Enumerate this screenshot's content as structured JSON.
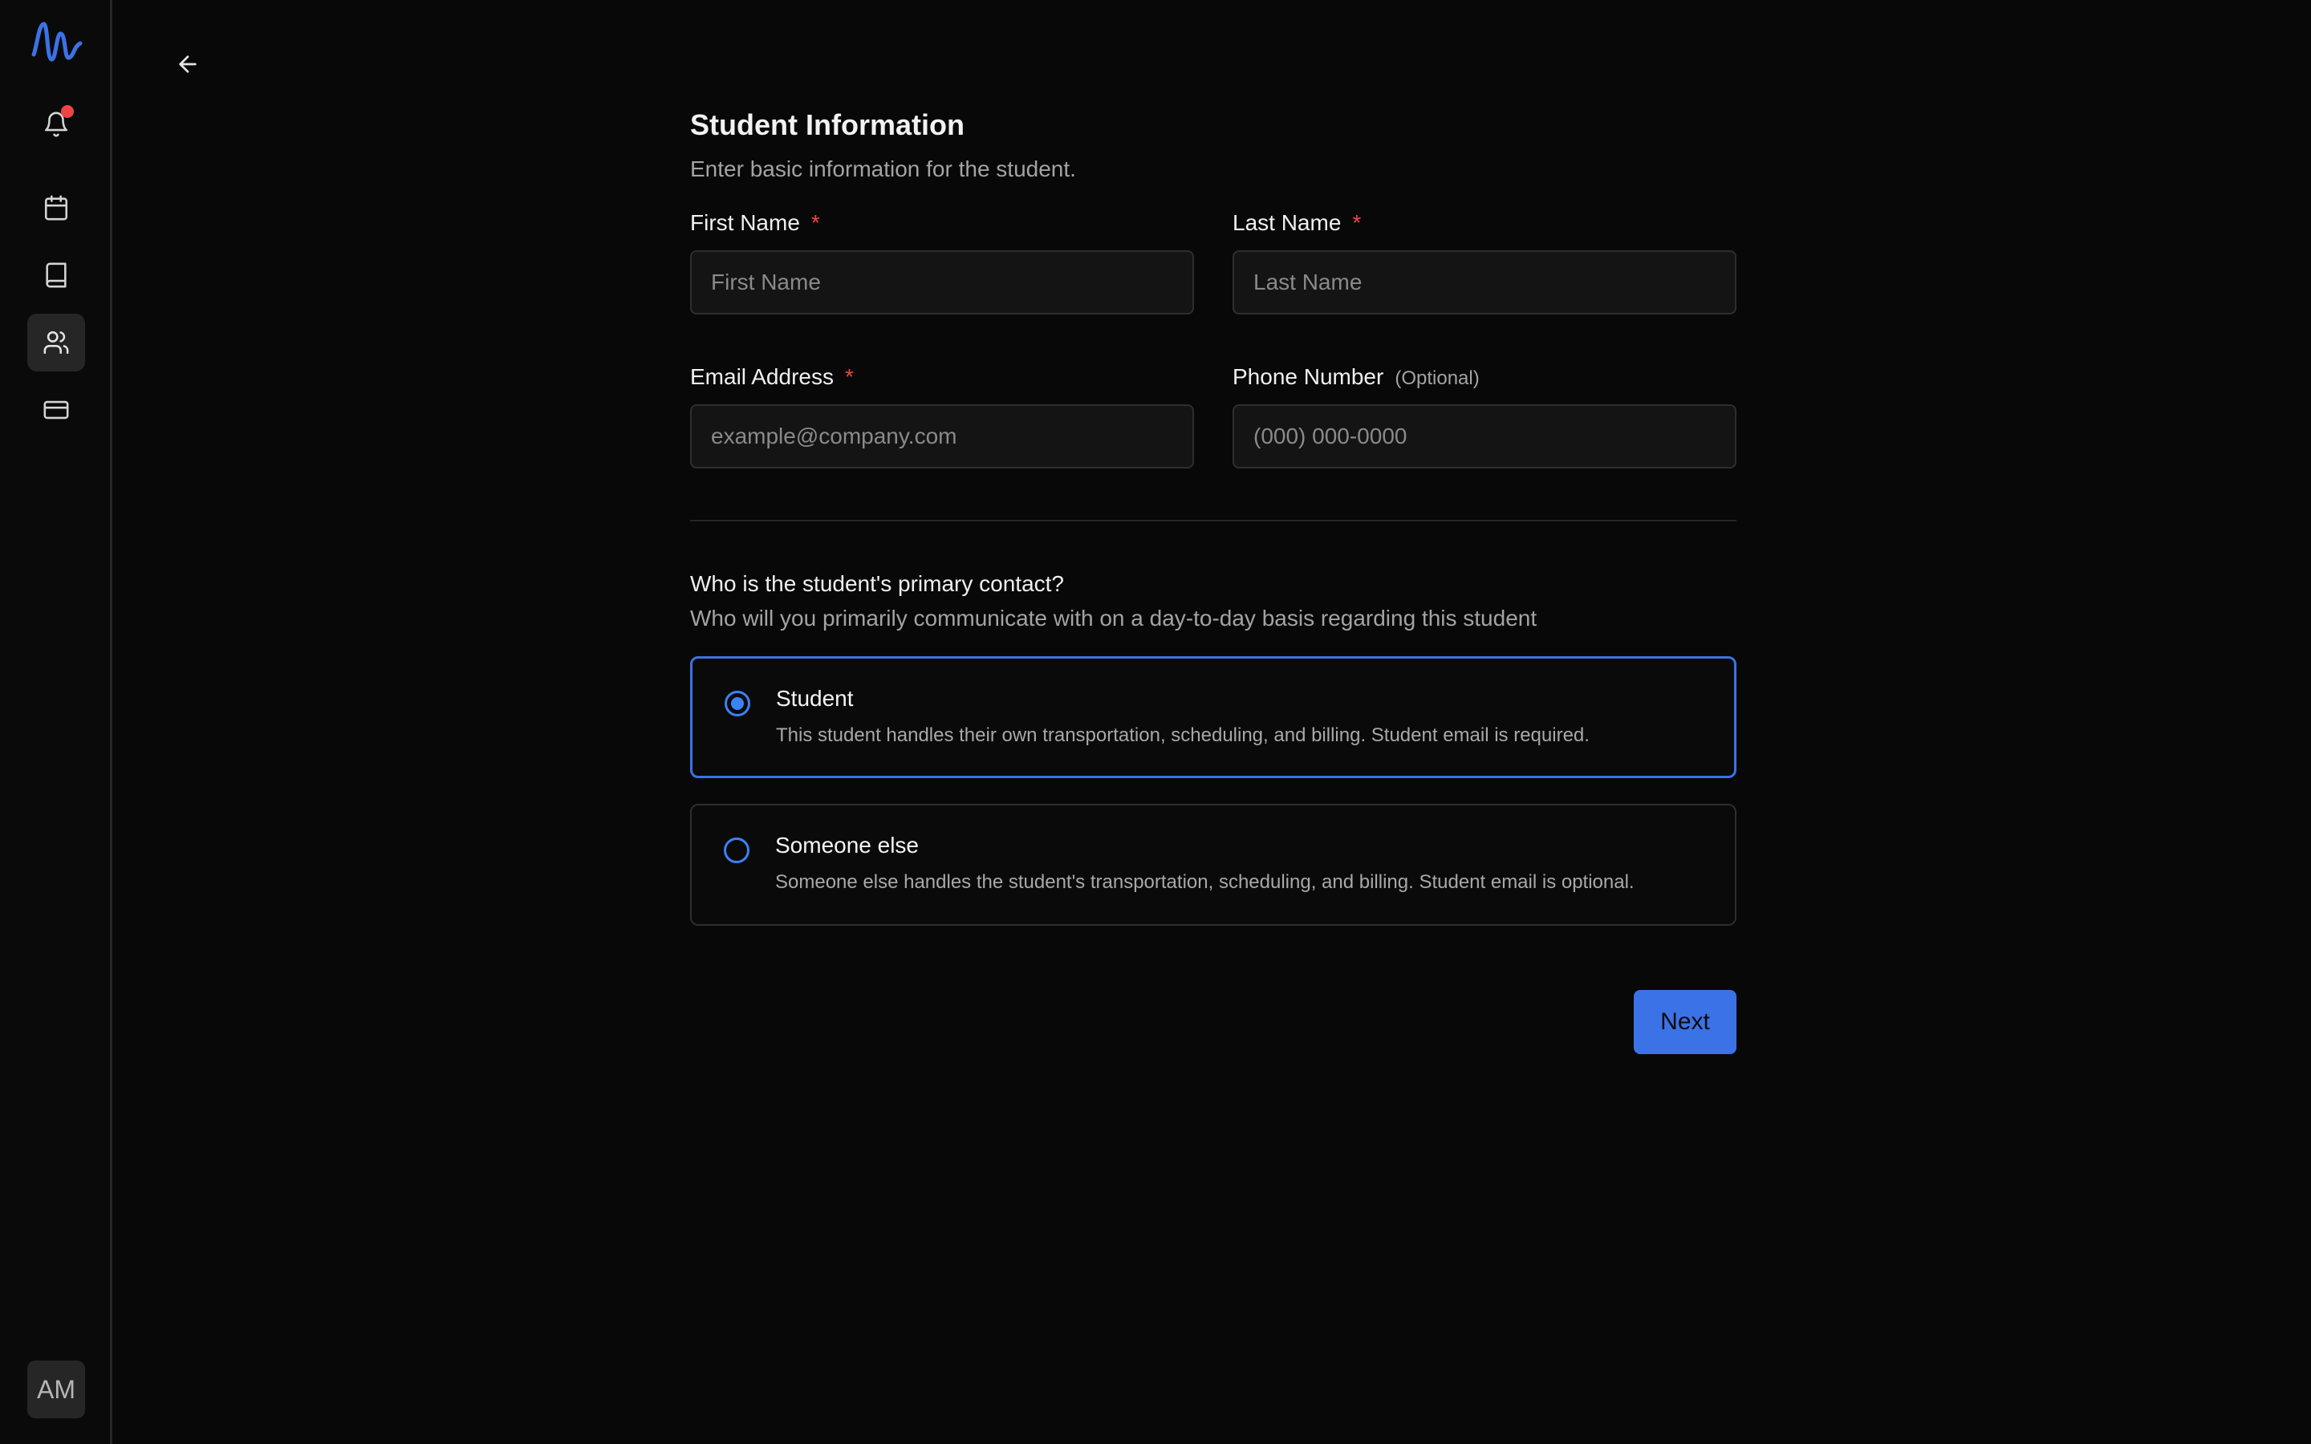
{
  "sidebar": {
    "logo_icon": "waveform-logo-icon",
    "items": [
      {
        "name": "notifications",
        "icon": "bell-icon",
        "has_badge": true
      },
      {
        "name": "calendar",
        "icon": "calendar-icon"
      },
      {
        "name": "lessons",
        "icon": "book-icon"
      },
      {
        "name": "students",
        "icon": "users-icon",
        "active": true
      },
      {
        "name": "billing",
        "icon": "credit-card-icon"
      }
    ],
    "avatar_initials": "AM"
  },
  "header": {
    "back_icon": "arrow-left-icon"
  },
  "form": {
    "title": "Student Information",
    "subtitle": "Enter basic information for the student.",
    "fields": {
      "first_name": {
        "label": "First Name",
        "required_mark": "*",
        "placeholder": "First Name",
        "value": ""
      },
      "last_name": {
        "label": "Last Name",
        "required_mark": "*",
        "placeholder": "Last Name",
        "value": ""
      },
      "email": {
        "label": "Email Address",
        "required_mark": "*",
        "placeholder": "example@company.com",
        "value": ""
      },
      "phone": {
        "label": "Phone Number",
        "optional_text": "(Optional)",
        "placeholder": "(000) 000-0000",
        "value": ""
      }
    },
    "primary_contact": {
      "question": "Who is the student's primary contact?",
      "description": "Who will you primarily communicate with on a day-to-day basis regarding this student",
      "options": [
        {
          "title": "Student",
          "description": "This student handles their own transportation, scheduling, and billing. Student email is required.",
          "selected": true
        },
        {
          "title": "Someone else",
          "description": "Someone else handles the student's transportation, scheduling, and billing. Student email is optional.",
          "selected": false
        }
      ]
    },
    "next_label": "Next"
  },
  "colors": {
    "accent": "#3b72e6",
    "required": "#ef4444",
    "background": "#080808"
  }
}
